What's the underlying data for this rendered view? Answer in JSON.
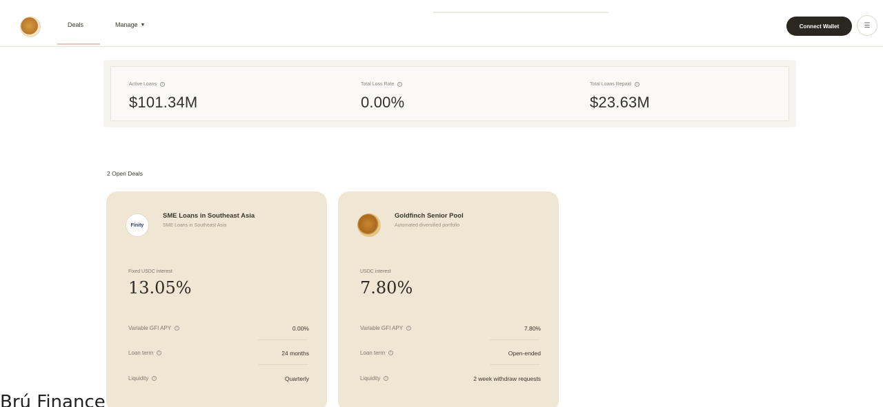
{
  "nav": {
    "deals": "Deals",
    "manage": "Manage",
    "connect_wallet": "Connect Wallet",
    "menu_icon": "menu-icon"
  },
  "stats": [
    {
      "label": "Active Loans",
      "value": "$101.34M"
    },
    {
      "label": "Total Loss Rate",
      "value": "0.00%"
    },
    {
      "label": "Total Loans Repaid",
      "value": "$23.63M"
    }
  ],
  "open_deals_label": "2 Open Deals",
  "deals": [
    {
      "logo_text": "Fínity",
      "title": "SME Loans in Southeast Asia",
      "subtitle": "SME Loans in Southeast Asia",
      "apy_label": "Fixed USDC interest",
      "apy": "13.05%",
      "rows": [
        {
          "label": "Variable GFI APY",
          "value": "0.00%"
        },
        {
          "label": "Loan term",
          "value": "24 months"
        },
        {
          "label": "Liquidity",
          "value": "Quarterly"
        }
      ]
    },
    {
      "logo_text": "",
      "title": "Goldfinch Senior Pool",
      "subtitle": "Automated diversified portfolio",
      "apy_label": "USDC interest",
      "apy": "7.80%",
      "rows": [
        {
          "label": "Variable GFI APY",
          "value": "7.80%"
        },
        {
          "label": "Loan term",
          "value": "Open-ended"
        },
        {
          "label": "Liquidity",
          "value": "2 week withdraw requests"
        }
      ]
    }
  ],
  "footer": "Brú Finance",
  "colors": {
    "card_bg": "#efe6d4",
    "button_bg": "#2a2620",
    "accent": "#e9c6b7"
  }
}
